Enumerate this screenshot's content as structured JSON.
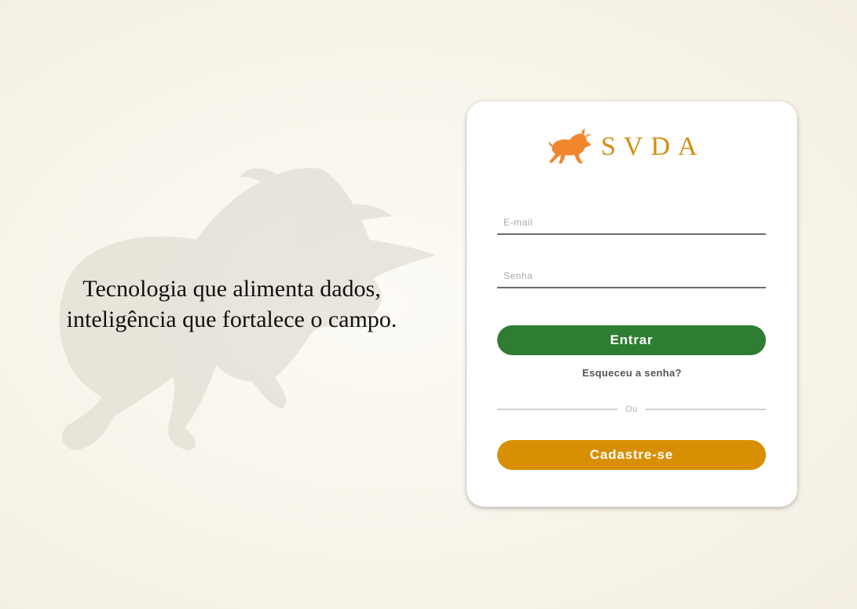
{
  "tagline": {
    "line1": "Tecnologia que alimenta dados,",
    "line2": "inteligência que fortalece o campo."
  },
  "brand": {
    "name": "SVDA",
    "logo_icon": "bull-icon",
    "color": "#d48d10",
    "icon_color": "#f2862e"
  },
  "form": {
    "email_placeholder": "E-mail",
    "password_placeholder": "Senha",
    "login_label": "Entrar",
    "forgot_label": "Esqueceu a senha?",
    "divider_label": "Ou",
    "signup_label": "Cadastre-se"
  },
  "colors": {
    "login_button": "#2e7d32",
    "signup_button": "#d88f03",
    "background": "#f8f4ea"
  }
}
